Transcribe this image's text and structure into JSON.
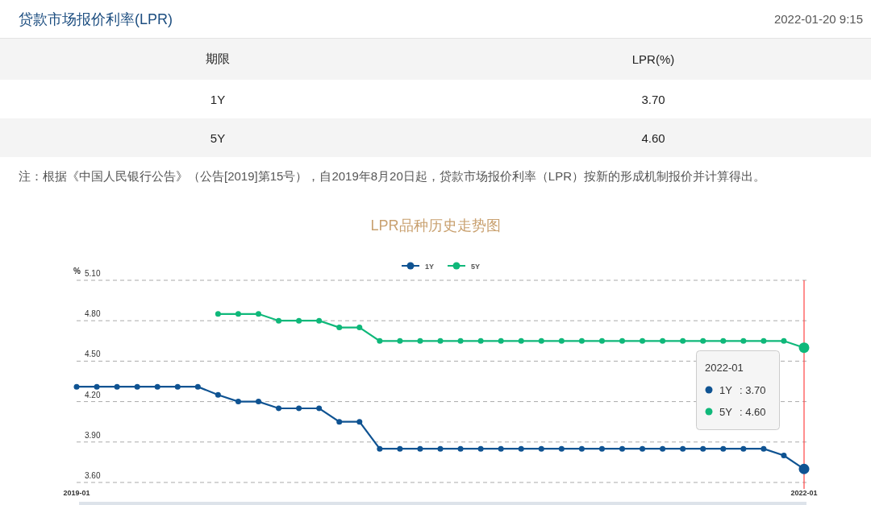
{
  "header": {
    "title": "贷款市场报价利率(LPR)",
    "timestamp": "2022-01-20 9:15"
  },
  "table": {
    "columns": [
      "期限",
      "LPR(%)"
    ],
    "rows": [
      [
        "1Y",
        "3.70"
      ],
      [
        "5Y",
        "4.60"
      ]
    ]
  },
  "note": "注：根据《中国人民银行公告》（公告[2019]第15号），自2019年8月20日起，贷款市场报价利率（LPR）按新的形成机制报价并计算得出。",
  "chart": {
    "title": "LPR品种历史走势图",
    "chart_data": {
      "type": "line",
      "ylabel": "%",
      "categories": [
        "2019-01",
        null,
        null,
        null,
        null,
        null,
        null,
        null,
        null,
        null,
        null,
        null,
        null,
        null,
        null,
        null,
        null,
        null,
        null,
        null,
        null,
        null,
        null,
        null,
        null,
        null,
        null,
        null,
        null,
        null,
        null,
        null,
        null,
        null,
        null,
        null,
        "2022-01"
      ],
      "grid": true,
      "legend": "top",
      "ref_lines": [
        {
          "axis": "x",
          "value": "2022-01",
          "color": "#ff4444"
        }
      ],
      "series": [
        {
          "name": "1Y",
          "color": "#0f5392",
          "marker": "circle",
          "values": [
            4.31,
            4.31,
            4.31,
            4.31,
            4.31,
            4.31,
            4.31,
            4.25,
            4.2,
            4.2,
            4.15,
            4.15,
            4.15,
            4.05,
            4.05,
            3.85,
            3.85,
            3.85,
            3.85,
            3.85,
            3.85,
            3.85,
            3.85,
            3.85,
            3.85,
            3.85,
            3.85,
            3.85,
            3.85,
            3.85,
            3.85,
            3.85,
            3.85,
            3.85,
            3.85,
            3.8,
            3.7
          ]
        },
        {
          "name": "5Y",
          "color": "#0fb87a",
          "marker": "circle",
          "values": [
            null,
            null,
            null,
            null,
            null,
            null,
            null,
            4.85,
            4.85,
            4.85,
            4.8,
            4.8,
            4.8,
            4.75,
            4.75,
            4.65,
            4.65,
            4.65,
            4.65,
            4.65,
            4.65,
            4.65,
            4.65,
            4.65,
            4.65,
            4.65,
            4.65,
            4.65,
            4.65,
            4.65,
            4.65,
            4.65,
            4.65,
            4.65,
            4.65,
            4.65,
            4.6
          ]
        }
      ],
      "ylim": [
        3.6,
        5.1
      ],
      "yticks": [
        {
          "value": 3.6,
          "label": "3.60"
        },
        {
          "value": 3.9,
          "label": "3.90"
        },
        {
          "value": 4.2,
          "label": "4.20"
        },
        {
          "value": 4.5,
          "label": "4.50"
        },
        {
          "value": 4.8,
          "label": "4.80"
        },
        {
          "value": 5.1,
          "label": "5.10"
        }
      ]
    },
    "tooltip": {
      "title": "2022-01",
      "items": [
        {
          "name": "1Y",
          "value": ": 3.70",
          "color": "#0f5392"
        },
        {
          "name": "5Y",
          "value": ": 4.60",
          "color": "#0fb87a"
        }
      ]
    }
  }
}
